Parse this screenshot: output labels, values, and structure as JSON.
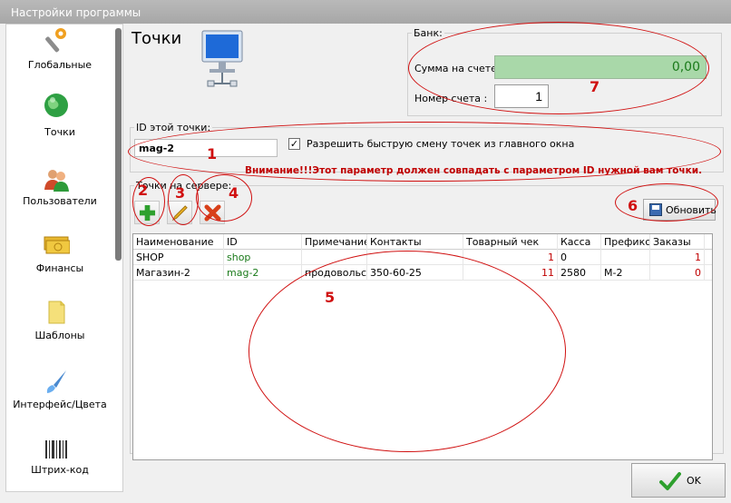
{
  "window": {
    "title": "Настройки программы"
  },
  "sidebar": {
    "items": [
      {
        "label": "Глобальные",
        "icon": "wrench-icon"
      },
      {
        "label": "Точки",
        "icon": "globe-icon"
      },
      {
        "label": "Пользователи",
        "icon": "users-icon"
      },
      {
        "label": "Финансы",
        "icon": "money-icon"
      },
      {
        "label": "Шаблоны",
        "icon": "note-icon"
      },
      {
        "label": "Интерфейс/Цвета",
        "icon": "brush-icon"
      },
      {
        "label": "Штрих-код",
        "icon": "barcode-icon"
      }
    ]
  },
  "page": {
    "title": "Точки",
    "icon": "network-computer-icon"
  },
  "bank": {
    "legend": "Банк:",
    "balance_label": "Сумма на счете:",
    "balance_value": "0,00",
    "account_label": "Номер счета :",
    "account_value": "1"
  },
  "point": {
    "legend": "ID этой точки:",
    "id_value": "mag-2",
    "checkbox_checked": true,
    "checkbox_label": "Разрешить быструю смену точек из главного окна",
    "warning": "Внимание!!!Этот параметр должен совпадать с параметром ID нужной вам точки."
  },
  "server": {
    "legend": "Точки на сервере:",
    "refresh_label": "Обновить",
    "columns": [
      "Наименование",
      "ID",
      "Примечание",
      "Контакты",
      "Товарный чек",
      "Касса",
      "Префикс",
      "Заказы"
    ],
    "rows": [
      [
        "SHOP",
        "shop",
        "",
        "",
        "1",
        "0",
        "",
        "1"
      ],
      [
        "Магазин-2",
        "mag-2",
        "продовольс...",
        "350-60-25",
        "11",
        "2580",
        "М-2",
        "0"
      ]
    ]
  },
  "footer": {
    "ok_label": "OK"
  },
  "annotations": [
    "1",
    "2",
    "3",
    "4",
    "5",
    "6",
    "7"
  ],
  "colors": {
    "accent_red": "#d01010",
    "balance_bg": "#a9d8a9",
    "green_text": "#1a7a1a"
  }
}
